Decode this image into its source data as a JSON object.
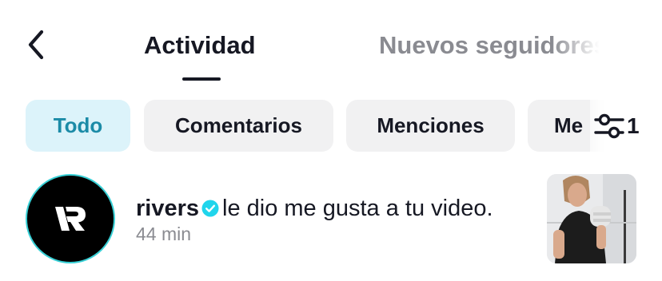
{
  "header": {
    "tabs": [
      {
        "label": "Actividad",
        "active": true
      },
      {
        "label": "Nuevos seguidores",
        "active": false
      }
    ]
  },
  "filters": {
    "chips": [
      {
        "label": "Todo",
        "active": true
      },
      {
        "label": "Comentarios",
        "active": false
      },
      {
        "label": "Menciones",
        "active": false
      },
      {
        "label": "Me",
        "active": false
      }
    ],
    "filter_count": "1",
    "icon": "sliders-icon"
  },
  "notifications": [
    {
      "username": "rivers",
      "verified": true,
      "action": "le dio me gusta a tu video.",
      "time": "44 min",
      "avatar_icon": "r-logo",
      "thumbnail": "boxing-video-thumbnail"
    }
  ],
  "colors": {
    "active_chip_bg": "#dcf3fa",
    "active_chip_text": "#1b8ba7",
    "chip_bg": "#f1f1f2",
    "verified": "#20d5ec",
    "avatar_ring": "#37cfd5",
    "muted_text": "#8a8b91"
  }
}
